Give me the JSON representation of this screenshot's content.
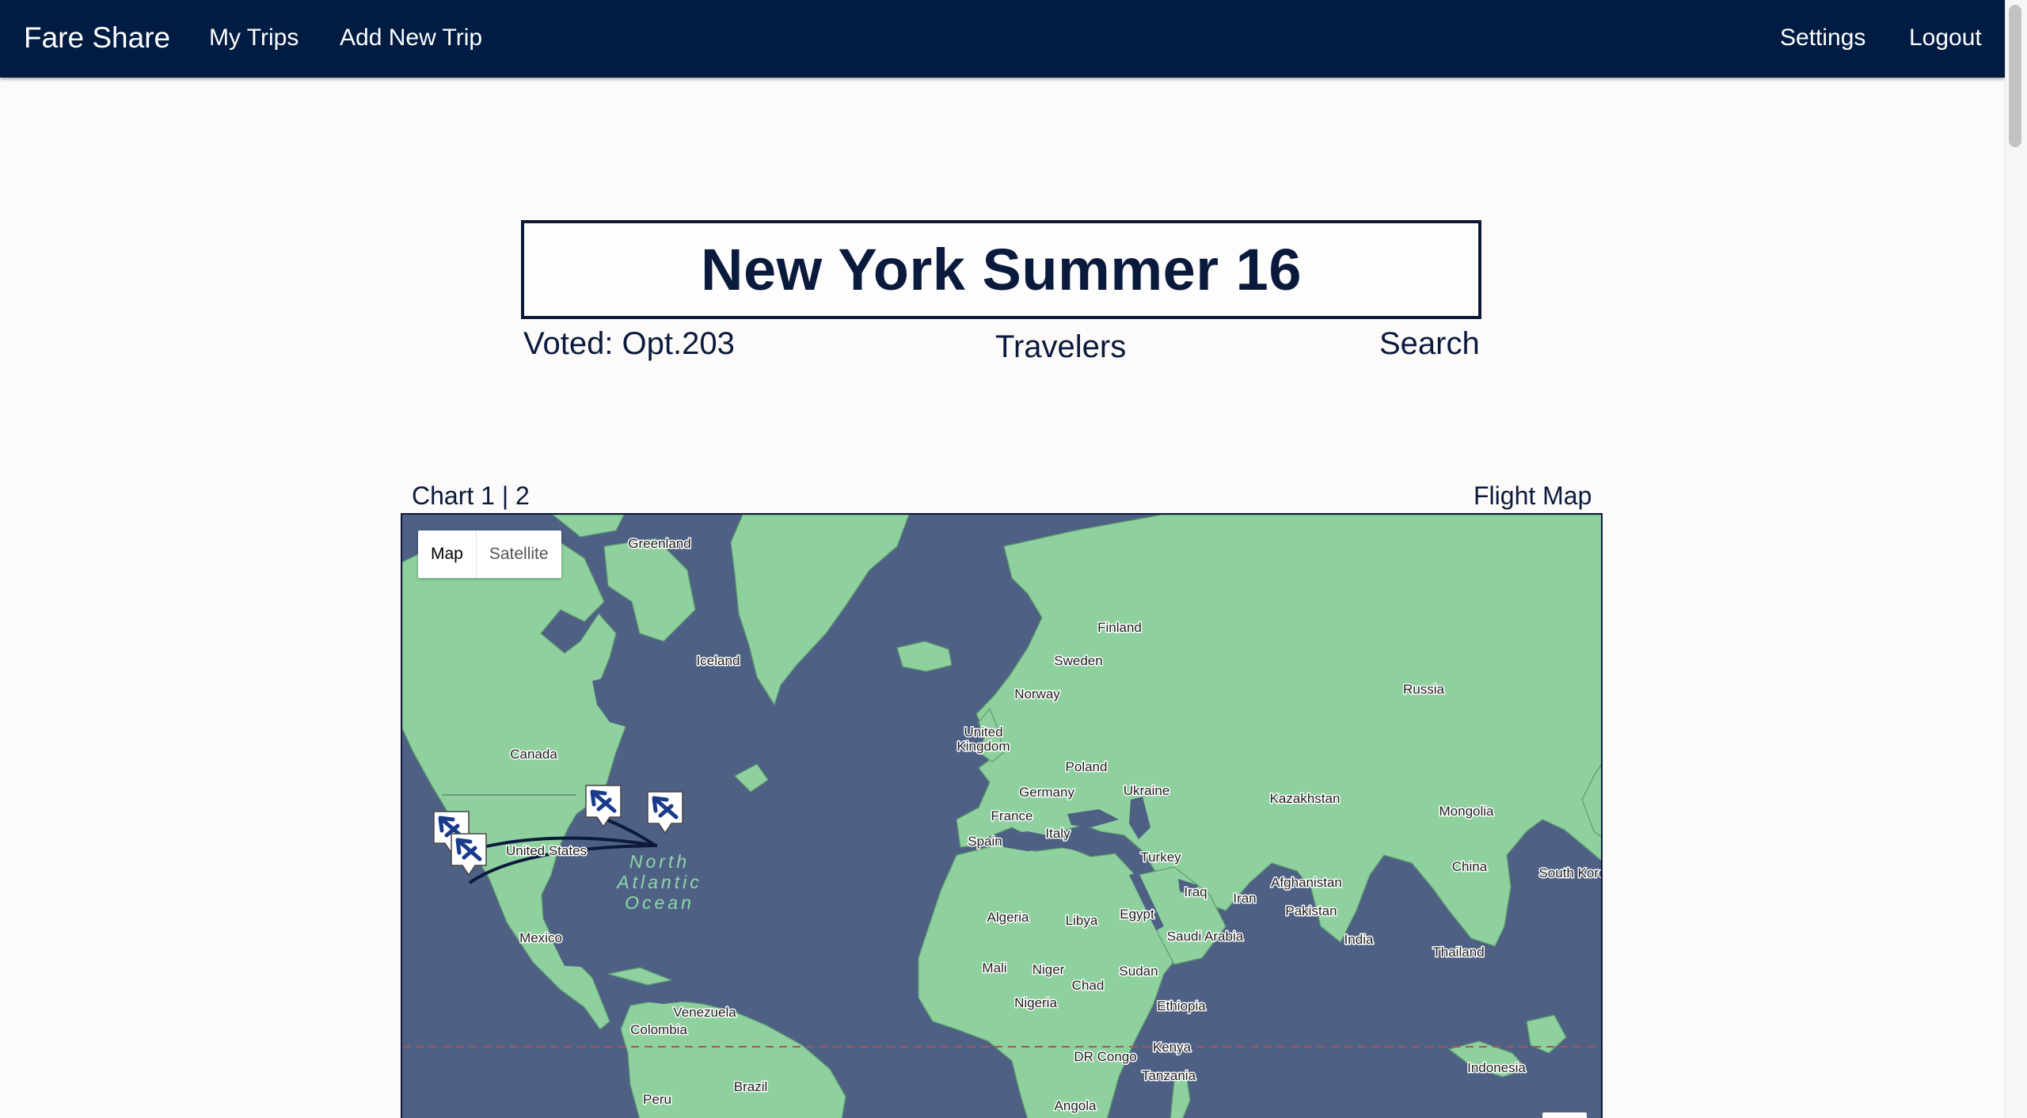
{
  "nav": {
    "brand": "Fare Share",
    "my_trips": "My Trips",
    "add_new_trip": "Add New Trip",
    "settings": "Settings",
    "logout": "Logout"
  },
  "trip": {
    "title": "New York Summer 16",
    "voted": "Voted: Opt.203",
    "travelers": "Travelers",
    "search": "Search"
  },
  "chart_nav": {
    "prefix": "Chart",
    "option_1": "1",
    "separator": "|",
    "option_2": "2"
  },
  "map": {
    "title": "Flight Map",
    "type_map": "Map",
    "type_satellite": "Satellite",
    "ocean_label": [
      "North",
      "Atlantic",
      "Ocean"
    ],
    "places": [
      "Greenland",
      "Iceland",
      "Finland",
      "Sweden",
      "Norway",
      "United",
      "Kingdom",
      "Russia",
      "Canada",
      "United States",
      "Mexico",
      "Poland",
      "Germany",
      "Ukraine",
      "France",
      "Kazakhstan",
      "Mongolia",
      "Italy",
      "Spain",
      "Turkey",
      "Iraq",
      "Iran",
      "Afghanistan",
      "China",
      "South Kore",
      "Pakistan",
      "Algeria",
      "Libya",
      "Egypt",
      "Saudi Arabia",
      "India",
      "Thailand",
      "Mali",
      "Niger",
      "Sudan",
      "Chad",
      "Nigeria",
      "Ethiopia",
      "Venezuela",
      "Colombia",
      "Kenya",
      "DR Congo",
      "Indonesia",
      "Tanzania",
      "Brazil",
      "Peru",
      "Angola"
    ],
    "colors": {
      "water": "#4e6185",
      "land": "#8ed19e",
      "route": "#0c1a3c",
      "pin": "#1a3a8a"
    },
    "markers": [
      "airport-pin-la",
      "airport-pin-sf",
      "airport-pin-chicago",
      "airport-pin-nyc"
    ]
  }
}
